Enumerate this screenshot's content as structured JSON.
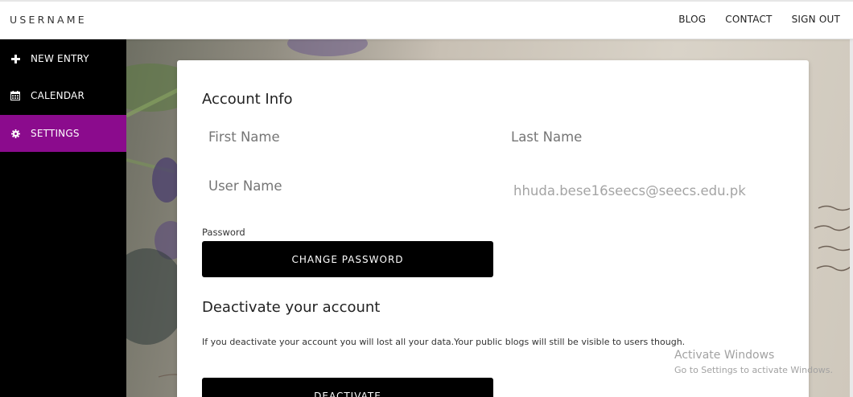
{
  "brand": {
    "name": "USERNAME"
  },
  "topnav": {
    "blog": "BLOG",
    "contact": "CONTACT",
    "signout": "SIGN OUT"
  },
  "sidebar": {
    "items": [
      {
        "label": "NEW ENTRY",
        "icon": "plus-icon"
      },
      {
        "label": "CALENDAR",
        "icon": "calendar-icon"
      },
      {
        "label": "SETTINGS",
        "icon": "gear-icon",
        "active": true
      }
    ],
    "active_color": "#8b0b8d"
  },
  "account": {
    "title": "Account Info",
    "first_name_placeholder": "First Name",
    "last_name_placeholder": "Last Name",
    "user_name_placeholder": "User Name",
    "email": "hhuda.bese16seecs@seecs.edu.pk",
    "password_label": "Password",
    "change_password_label": "CHANGE PASSWORD"
  },
  "deactivate": {
    "title": "Deactivate your account",
    "note": "If you deactivate your account you will lost all your data.Your public blogs will still be visible to users though.",
    "button_label": "DEACTIVATE"
  },
  "watermark": {
    "line1": "Activate Windows",
    "line2": "Go to Settings to activate Windows."
  }
}
